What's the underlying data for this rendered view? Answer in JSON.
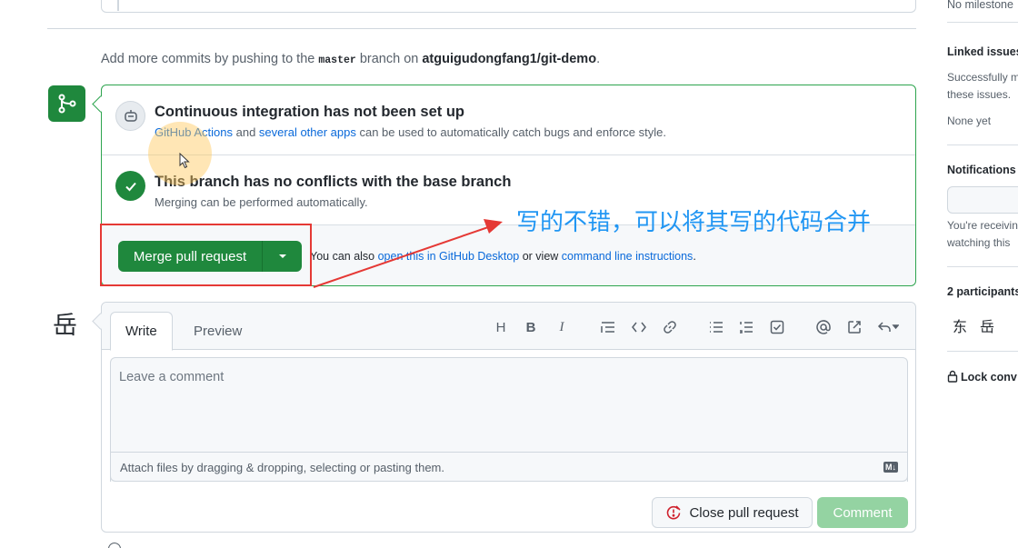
{
  "push_note": {
    "prefix": "Add more commits by pushing to the ",
    "branch": "master",
    "middle": " branch on ",
    "repo": "atguigudongfang1/git-demo",
    "suffix": "."
  },
  "ci": {
    "title": "Continuous integration has not been set up",
    "link1": "GitHub Actions",
    "and": " and ",
    "link2": "several other apps",
    "rest": " can be used to automatically catch bugs and enforce style."
  },
  "conflicts": {
    "title": "This branch has no conflicts with the base branch",
    "subtitle": "Merging can be performed automatically."
  },
  "merge": {
    "button_label": "Merge pull request",
    "also_prefix": "You can also ",
    "link_desktop": "open this in GitHub Desktop",
    "or_view": " or view ",
    "link_cli": "command line instructions",
    "suffix": "."
  },
  "annotation": {
    "text": "写的不错，可以将其写的代码合并",
    "color": "#2196f3",
    "box_color": "#e53935"
  },
  "comment": {
    "avatar_char": "岳",
    "tabs": [
      "Write",
      "Preview"
    ],
    "toolbar": [
      "H",
      "B",
      "I",
      "⁝≡",
      "<>",
      "🔗",
      "≡",
      "1≡",
      "☑",
      "@",
      "↗",
      "↶▾"
    ],
    "placeholder": "Leave a comment",
    "attach_text": "Attach files by dragging & dropping, selecting or pasting them.",
    "md_badge": "M↓",
    "close_label": "Close pull request",
    "comment_label": "Comment"
  },
  "sidebar": {
    "milestone_none": "No milestone",
    "linked_head": "Linked issues",
    "linked_desc1": "Successfully m",
    "linked_desc2": "these issues.",
    "linked_none": "None yet",
    "notif_head": "Notifications",
    "notif_desc1": "You're receivin",
    "notif_desc2": "watching this",
    "participants_head": "2 participants",
    "participant1": "东",
    "participant2": "岳",
    "lock_label": "Lock conv"
  },
  "colors": {
    "merge_green": "#1f883d",
    "link_blue": "#0969da",
    "comment_disabled": "#94d3a2"
  }
}
